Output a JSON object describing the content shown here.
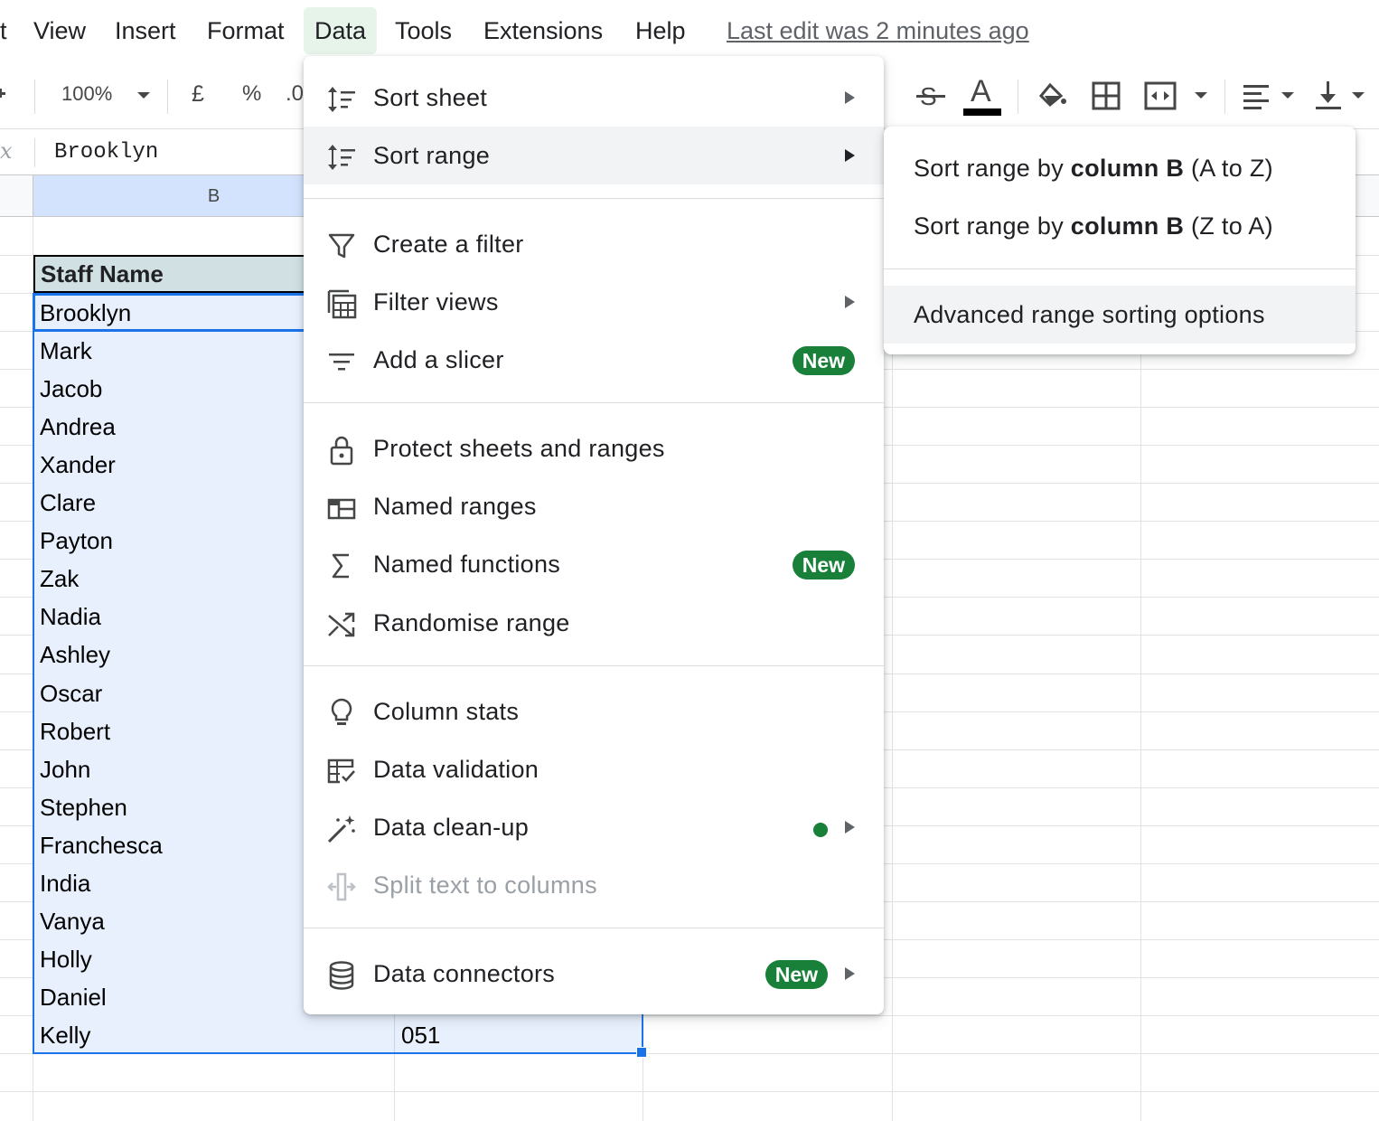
{
  "menubar": {
    "items": [
      "t",
      "View",
      "Insert",
      "Format",
      "Data",
      "Tools",
      "Extensions",
      "Help"
    ],
    "active": "Data",
    "last_edit": "Last edit was 2 minutes ago"
  },
  "toolbar": {
    "zoom": "100%",
    "currency": "£",
    "percent": "%",
    "decimal": ".0"
  },
  "formula_bar": {
    "fx_label": "fx",
    "value": "Brooklyn"
  },
  "sheet": {
    "column_header": "B",
    "header_cell": "Staff Name",
    "names": [
      "Brooklyn",
      "Mark",
      "Jacob",
      "Andrea",
      "Xander",
      "Clare",
      "Payton",
      "Zak",
      "Nadia",
      "Ashley",
      "Oscar",
      "Robert",
      "John",
      "Stephen",
      "Franchesca",
      "India",
      "Vanya",
      "Holly",
      "Daniel",
      "Kelly"
    ],
    "visible_value_col_c_last": "051"
  },
  "data_menu": {
    "items": [
      {
        "label": "Sort sheet",
        "icon": "sort-icon",
        "submenu": true
      },
      {
        "label": "Sort range",
        "icon": "sort-icon",
        "submenu": true,
        "highlighted": true
      },
      {
        "label": "Create a filter",
        "icon": "filter-icon"
      },
      {
        "label": "Filter views",
        "icon": "filter-views-icon",
        "submenu": true
      },
      {
        "label": "Add a slicer",
        "icon": "slicer-icon",
        "badge": "New"
      },
      {
        "label": "Protect sheets and ranges",
        "icon": "lock-icon"
      },
      {
        "label": "Named ranges",
        "icon": "named-ranges-icon"
      },
      {
        "label": "Named functions",
        "icon": "sigma-icon",
        "badge": "New"
      },
      {
        "label": "Randomise range",
        "icon": "shuffle-icon"
      },
      {
        "label": "Column stats",
        "icon": "lightbulb-icon"
      },
      {
        "label": "Data validation",
        "icon": "data-validation-icon"
      },
      {
        "label": "Data clean-up",
        "icon": "magic-wand-icon",
        "submenu": true,
        "dot": true
      },
      {
        "label": "Split text to columns",
        "icon": "split-icon",
        "disabled": true
      },
      {
        "label": "Data connectors",
        "icon": "database-icon",
        "submenu": true,
        "badge": "New"
      }
    ]
  },
  "sort_range_submenu": {
    "az_prefix": "Sort range by ",
    "az_bold": "column B",
    "az_suffix": " (A to Z)",
    "za_prefix": "Sort range by ",
    "za_bold": "column B",
    "za_suffix": " (Z to A)",
    "advanced": "Advanced range sorting options"
  },
  "colors": {
    "accent": "#1a73e8",
    "badge_green": "#188038",
    "selection_fill": "#e8f0fe",
    "header_fill": "#d0e0e3"
  }
}
